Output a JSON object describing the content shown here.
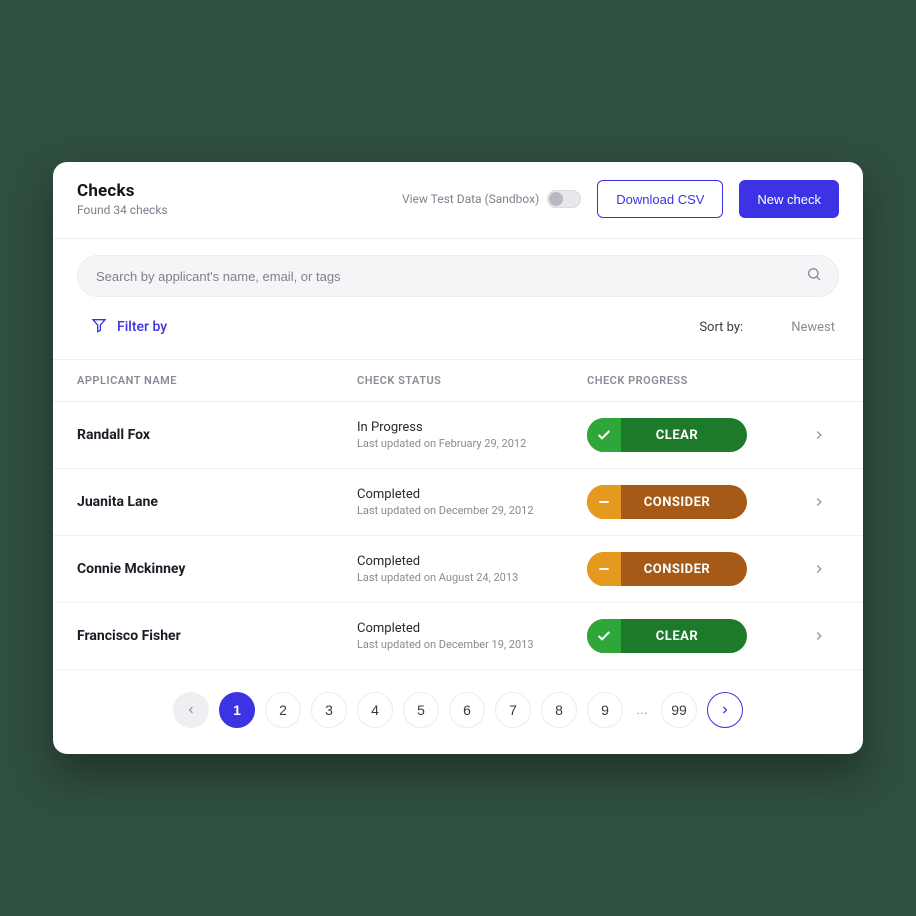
{
  "header": {
    "title": "Checks",
    "subtitle": "Found 34 checks",
    "sandbox_label": "View Test Data (Sandbox)",
    "download_label": "Download CSV",
    "new_label": "New check"
  },
  "search": {
    "placeholder": "Search by applicant's name, email, or tags"
  },
  "filter": {
    "label": "Filter by"
  },
  "sort": {
    "label": "Sort by:",
    "value": "Newest"
  },
  "columns": {
    "name": "APPLICANT NAME",
    "status": "CHECK STATUS",
    "progress": "CHECK PROGRESS"
  },
  "rows": [
    {
      "name": "Randall Fox",
      "status": "In Progress",
      "updated": "Last updated on February 29, 2012",
      "progress": "CLEAR",
      "type": "clear"
    },
    {
      "name": "Juanita Lane",
      "status": "Completed",
      "updated": "Last updated on December 29, 2012",
      "progress": "CONSIDER",
      "type": "consider"
    },
    {
      "name": "Connie Mckinney",
      "status": "Completed",
      "updated": "Last updated on August 24, 2013",
      "progress": "CONSIDER",
      "type": "consider"
    },
    {
      "name": "Francisco Fisher",
      "status": "Completed",
      "updated": "Last updated on December 19, 2013",
      "progress": "CLEAR",
      "type": "clear"
    }
  ],
  "pager": {
    "pages": [
      "1",
      "2",
      "3",
      "4",
      "5",
      "6",
      "7",
      "8",
      "9"
    ],
    "ellipsis": "...",
    "last": "99",
    "active": "1"
  }
}
